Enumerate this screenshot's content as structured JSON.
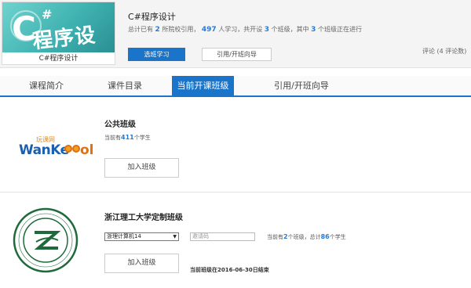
{
  "course": {
    "cover_caption": "C#程序设计",
    "cover_c": "C",
    "cover_sharp": "#",
    "cover_title": "程序设计",
    "title": "C#程序设计",
    "stats": {
      "p1": "总计已有",
      "schools": "2",
      "p2": "所院校引用，",
      "learners": "497",
      "p3": "人学习，共开设",
      "classes": "3",
      "p4": "个班级，其中",
      "ongoing": "3",
      "p5": "个班级正在进行"
    },
    "select_button": "选班学习",
    "cite_button": "引用/开班向导",
    "comments": "评论 (4 评论数)"
  },
  "tabs": [
    {
      "label": "课程简介"
    },
    {
      "label": "课件目录"
    },
    {
      "label": "当前开课班级"
    },
    {
      "label": "引用/开班向导"
    }
  ],
  "classes": [
    {
      "logo_top": "玩课网",
      "logo_main": "WanKe",
      "logo_tail": "ol",
      "name": "公共班级",
      "count_prefix": "当前有",
      "count": "411",
      "count_suffix": "个学生",
      "join_label": "加入班级"
    },
    {
      "seal_text_top": "ZHEJIANG SCI-TECH UNIVERSITY",
      "seal_year": "1897",
      "seal_text_bottom": "浙江理工大学",
      "name": "浙江理工大学定制班级",
      "select_value": "浙理计算机14",
      "invite_placeholder": "邀请码",
      "count_p1": "当前有",
      "sub_classes": "2",
      "count_p2": "个班级，总计",
      "count": "86",
      "count_p3": "个学生",
      "join_label": "加入班级",
      "end_date": "当前班级在2016-06-30日结束"
    }
  ],
  "colors": {
    "accent": "#1a74c9",
    "number": "#2a7ad2"
  }
}
